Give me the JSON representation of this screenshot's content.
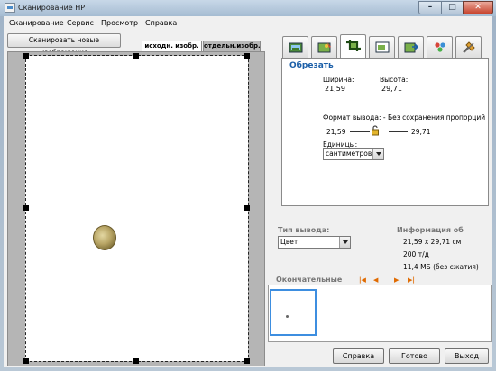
{
  "window": {
    "title": "Сканирование HP",
    "min_glyph": "–",
    "max_glyph": "□",
    "close_glyph": "✕"
  },
  "menu": [
    "Сканирование",
    "Сервис",
    "Просмотр",
    "Справка"
  ],
  "preview": {
    "scan_button": "Сканировать новые изображения",
    "tab_original": "исходн. изобр.",
    "tab_separate": "отдельн.изобр."
  },
  "toolbar_icons": [
    "scanner-photo-icon",
    "adjust-image-icon",
    "crop-icon",
    "resize-icon",
    "export-icon",
    "color-icon",
    "tools-icon"
  ],
  "crop": {
    "heading": "Обрезать",
    "width_label": "Ширина:",
    "width_value": "21,59",
    "height_label": "Высота:",
    "height_value": "29,71",
    "format_label": "Формат вывода: - Без сохранения пропорций",
    "format_width": "21,59",
    "format_height": "29,71",
    "units_label": "Единицы:",
    "units_value": "сантиметров"
  },
  "output": {
    "type_label": "Тип вывода:",
    "type_value": "Цвет",
    "info_label": "Информация об",
    "info_size": "21,59 x 29,71 см",
    "info_dpi": "200 т/д",
    "info_filesize": "11,4 МБ (без сжатия)"
  },
  "finals": {
    "label": "Окончательные"
  },
  "buttons": {
    "help": "Справка",
    "done": "Готово",
    "exit": "Выход"
  },
  "colors": {
    "accent": "#1b5fa8",
    "nav_arrow": "#e06a00",
    "selected_thumb": "#3d8ee0"
  }
}
